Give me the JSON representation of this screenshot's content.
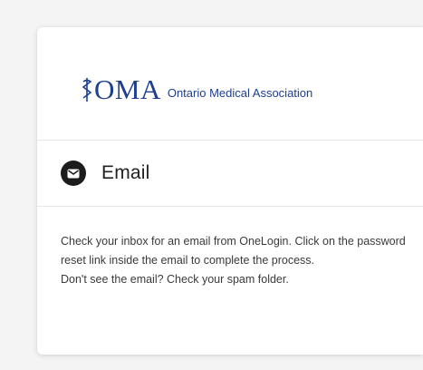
{
  "logo": {
    "mark": "OMA",
    "tagline": "Ontario Medical Association",
    "color": "#1d3f8f"
  },
  "method": {
    "icon": "envelope-icon",
    "title": "Email"
  },
  "message": {
    "line1": "Check your inbox for an email from OneLogin. Click on the password reset link inside the email to complete the process.",
    "line2": "Don't see the email? Check your spam folder."
  }
}
